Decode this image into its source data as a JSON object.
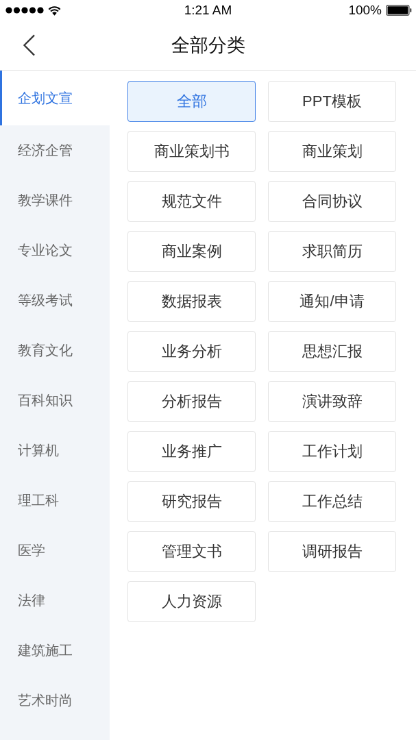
{
  "status_bar": {
    "time": "1:21 AM",
    "battery": "100%"
  },
  "nav": {
    "title": "全部分类"
  },
  "sidebar": {
    "items": [
      {
        "label": "企划文宣",
        "selected": true
      },
      {
        "label": "经济企管",
        "selected": false
      },
      {
        "label": "教学课件",
        "selected": false
      },
      {
        "label": "专业论文",
        "selected": false
      },
      {
        "label": "等级考试",
        "selected": false
      },
      {
        "label": "教育文化",
        "selected": false
      },
      {
        "label": "百科知识",
        "selected": false
      },
      {
        "label": "计算机",
        "selected": false
      },
      {
        "label": "理工科",
        "selected": false
      },
      {
        "label": "医学",
        "selected": false
      },
      {
        "label": "法律",
        "selected": false
      },
      {
        "label": "建筑施工",
        "selected": false
      },
      {
        "label": "艺术时尚",
        "selected": false
      }
    ]
  },
  "categories": [
    {
      "label": "全部",
      "selected": true
    },
    {
      "label": "PPT模板",
      "selected": false
    },
    {
      "label": "商业策划书",
      "selected": false
    },
    {
      "label": "商业策划",
      "selected": false
    },
    {
      "label": "规范文件",
      "selected": false
    },
    {
      "label": "合同协议",
      "selected": false
    },
    {
      "label": "商业案例",
      "selected": false
    },
    {
      "label": "求职简历",
      "selected": false
    },
    {
      "label": "数据报表",
      "selected": false
    },
    {
      "label": "通知/申请",
      "selected": false
    },
    {
      "label": "业务分析",
      "selected": false
    },
    {
      "label": "思想汇报",
      "selected": false
    },
    {
      "label": "分析报告",
      "selected": false
    },
    {
      "label": "演讲致辞",
      "selected": false
    },
    {
      "label": "业务推广",
      "selected": false
    },
    {
      "label": "工作计划",
      "selected": false
    },
    {
      "label": "研究报告",
      "selected": false
    },
    {
      "label": "工作总结",
      "selected": false
    },
    {
      "label": "管理文书",
      "selected": false
    },
    {
      "label": "调研报告",
      "selected": false
    },
    {
      "label": "人力资源",
      "selected": false
    }
  ]
}
